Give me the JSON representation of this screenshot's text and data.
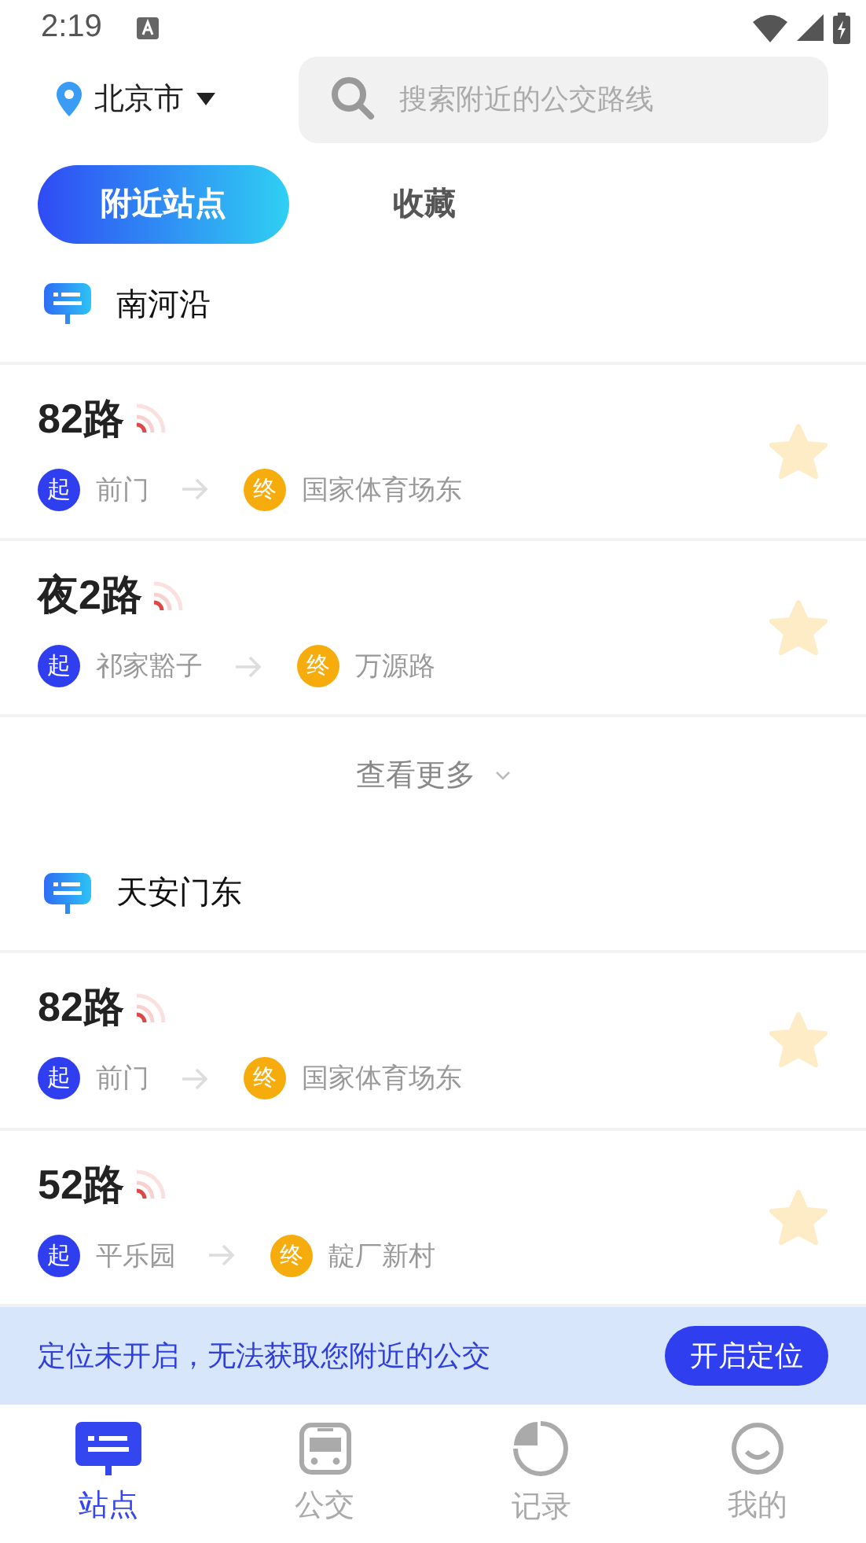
{
  "status_bar": {
    "time": "2:19"
  },
  "header": {
    "city": "北京市",
    "search": {
      "placeholder": "搜索附近的公交路线"
    }
  },
  "tabs": [
    {
      "label": "附近站点",
      "selected": true
    },
    {
      "label": "收藏",
      "selected": false
    }
  ],
  "stations": [
    {
      "name": "南河沿",
      "routes": [
        {
          "name": "82路",
          "start_tag": "起",
          "start": "前门",
          "end_tag": "终",
          "end": "国家体育场东",
          "favorite": false
        },
        {
          "name": "夜2路",
          "start_tag": "起",
          "start": "祁家豁子",
          "end_tag": "终",
          "end": "万源路",
          "favorite": false
        }
      ],
      "more": "查看更多"
    },
    {
      "name": "天安门东",
      "routes": [
        {
          "name": "82路",
          "start_tag": "起",
          "start": "前门",
          "end_tag": "终",
          "end": "国家体育场东",
          "favorite": false
        },
        {
          "name": "52路",
          "start_tag": "起",
          "start": "平乐园",
          "end_tag": "终",
          "end": "靛厂新村",
          "favorite": false
        }
      ]
    }
  ],
  "location_banner": {
    "message": "定位未开启，无法获取您附近的公交",
    "button": "开启定位"
  },
  "bottom_nav": [
    {
      "label": "站点",
      "kind": "station",
      "selected": true
    },
    {
      "label": "公交",
      "kind": "bus",
      "selected": false
    },
    {
      "label": "记录",
      "kind": "history",
      "selected": false
    },
    {
      "label": "我的",
      "kind": "profile",
      "selected": false
    }
  ]
}
